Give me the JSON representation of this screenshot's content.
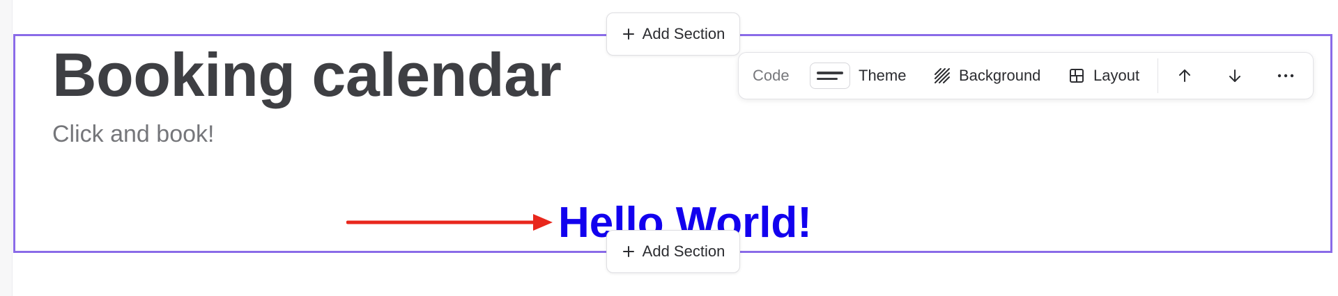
{
  "section": {
    "title": "Booking calendar",
    "subtitle": "Click and book!",
    "hello": "Hello World!"
  },
  "add_section": {
    "label": "Add Section"
  },
  "toolbar": {
    "code_label": "Code",
    "theme_label": "Theme",
    "background_label": "Background",
    "layout_label": "Layout"
  },
  "colors": {
    "selection_border": "#8a6be8",
    "title_text": "#3e3f43",
    "subtitle_text": "#75767a",
    "hello_text": "#1200ee",
    "arrow": "#e8271c"
  },
  "icons": {
    "add": "plus-icon",
    "theme": "theme-swatch-icon",
    "background": "diagonal-stripes-icon",
    "layout": "layout-grid-icon",
    "move_up": "arrow-up-icon",
    "move_down": "arrow-down-icon",
    "more": "more-horizontal-icon"
  }
}
